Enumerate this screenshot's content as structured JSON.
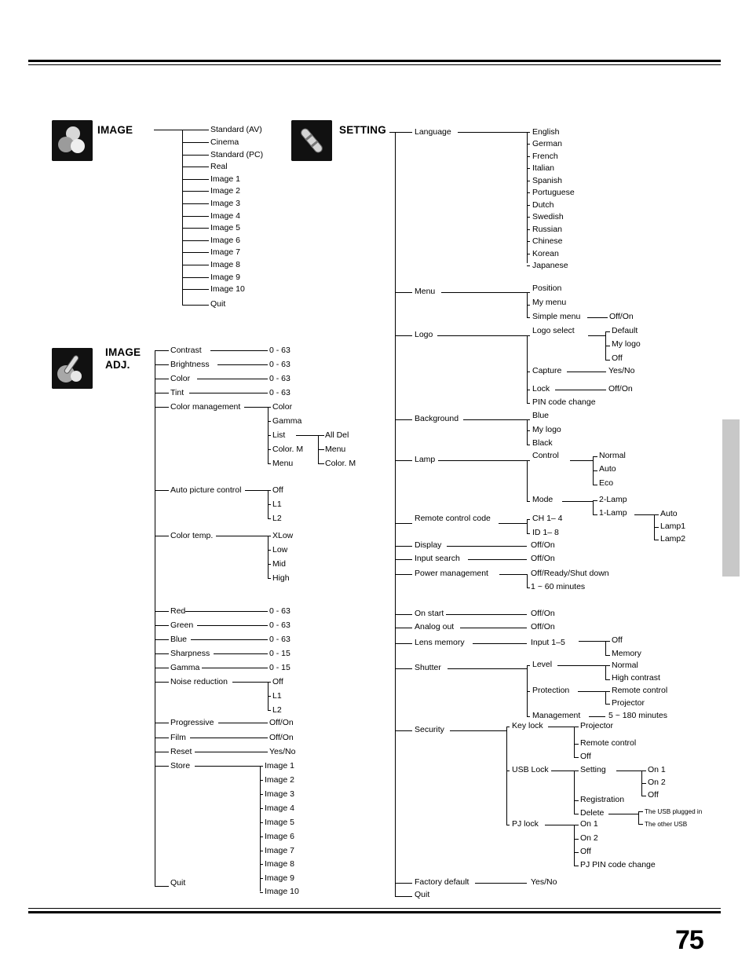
{
  "page": {
    "number": "75"
  },
  "sections": {
    "image": {
      "title": "IMAGE",
      "icon": "image-icon",
      "items": [
        "Standard (AV)",
        "Cinema",
        "Standard (PC)",
        "Real",
        "Image 1",
        "Image 2",
        "Image 3",
        "Image 4",
        "Image 5",
        "Image 6",
        "Image 7",
        "Image 8",
        "Image 9",
        "Image 10",
        "Quit"
      ]
    },
    "image_adj": {
      "title_line1": "IMAGE",
      "title_line2": "ADJ.",
      "icon": "image-adj-icon",
      "items": [
        {
          "label": "Contrast",
          "value": "0 - 63"
        },
        {
          "label": "Brightness",
          "value": "0 - 63"
        },
        {
          "label": "Color",
          "value": "0 - 63"
        },
        {
          "label": "Tint",
          "value": "0 - 63"
        },
        {
          "label": "Color management",
          "value": ""
        },
        {
          "label": "Auto picture control",
          "value": ""
        },
        {
          "label": "Color temp.",
          "value": ""
        },
        {
          "label": "Red",
          "value": "0 - 63"
        },
        {
          "label": "Green",
          "value": "0 - 63"
        },
        {
          "label": "Blue",
          "value": "0 - 63"
        },
        {
          "label": "Sharpness",
          "value": "0 - 15"
        },
        {
          "label": "Gamma",
          "value": "0 - 15"
        },
        {
          "label": "Noise reduction",
          "value": ""
        },
        {
          "label": "Progressive",
          "value": "Off/On"
        },
        {
          "label": "Film",
          "value": "Off/On"
        },
        {
          "label": "Reset",
          "value": "Yes/No"
        },
        {
          "label": "Store",
          "value": ""
        },
        {
          "label": "Quit",
          "value": ""
        }
      ],
      "color_management": [
        "Color",
        "Gamma",
        "List",
        "Color. M",
        "Menu"
      ],
      "color_management_sub": [
        "All Del",
        "Menu",
        "Color. M"
      ],
      "auto_picture_control": [
        "Off",
        "L1",
        "L2"
      ],
      "color_temp": [
        "XLow",
        "Low",
        "Mid",
        "High"
      ],
      "noise_reduction": [
        "Off",
        "L1",
        "L2"
      ],
      "store": [
        "Image 1",
        "Image 2",
        "Image 3",
        "Image 4",
        "Image 5",
        "Image 6",
        "Image 7",
        "Image 8",
        "Image 9",
        "Image 10"
      ]
    },
    "setting": {
      "title": "SETTING",
      "icon": "setting-icon",
      "language_label": "Language",
      "languages": [
        "English",
        "German",
        "French",
        "Italian",
        "Spanish",
        "Portuguese",
        "Dutch",
        "Swedish",
        "Russian",
        "Chinese",
        "Korean",
        "Japanese"
      ],
      "menu_label": "Menu",
      "menu_items": [
        "Position",
        "My menu",
        "Simple menu"
      ],
      "menu_simple_value": "Off/On",
      "logo_label": "Logo",
      "logo_items": [
        "Logo select",
        "Capture",
        "Lock",
        "PIN code change"
      ],
      "logo_select_items": [
        "Default",
        "My logo",
        "Off"
      ],
      "capture_value": "Yes/No",
      "lock_value": "Off/On",
      "background_label": "Background",
      "background_items": [
        "Blue",
        "My logo",
        "Black"
      ],
      "lamp_label": "Lamp",
      "lamp_items": [
        "Control",
        "Mode"
      ],
      "lamp_control_items": [
        "Normal",
        "Auto",
        "Eco"
      ],
      "lamp_mode_items": [
        "2-Lamp",
        "1-Lamp"
      ],
      "lamp_1lamp_items": [
        "Auto",
        "Lamp1",
        "Lamp2"
      ],
      "remote_label": "Remote control code",
      "remote_items": [
        "CH 1– 4",
        "ID 1– 8"
      ],
      "display_label": "Display",
      "display_value": "Off/On",
      "input_search_label": "Input search",
      "input_search_value": "Off/On",
      "power_mgmt_label": "Power management",
      "power_mgmt_items": [
        "Off/Ready/Shut down",
        "1 ~ 60 minutes"
      ],
      "on_start_label": "On start",
      "on_start_value": "Off/On",
      "analog_out_label": "Analog out",
      "analog_out_value": "Off/On",
      "lens_memory_label": "Lens memory",
      "lens_memory_value": "Input 1–5",
      "lens_memory_items": [
        "Off",
        "Memory"
      ],
      "shutter_label": "Shutter",
      "shutter_items": [
        "Level",
        "Protection",
        "Management"
      ],
      "shutter_level_items": [
        "Normal",
        "High contrast"
      ],
      "shutter_protection_items": [
        "Remote control",
        "Projector"
      ],
      "shutter_mgmt_value": "5 ~ 180 minutes",
      "security_label": "Security",
      "security_items": [
        "Key lock",
        "USB Lock",
        "PJ lock"
      ],
      "key_lock_items": [
        "Projector",
        "Remote control",
        "Off"
      ],
      "usb_lock_items": [
        "Setting",
        "Registration",
        "Delete"
      ],
      "usb_setting_items": [
        "On 1",
        "On 2",
        "Off"
      ],
      "usb_delete_items": [
        "The USB plugged in",
        "The other USB"
      ],
      "pj_lock_items": [
        "On 1",
        "On 2",
        "Off",
        "PJ PIN code change"
      ],
      "factory_default_label": "Factory default",
      "factory_default_value": "Yes/No",
      "quit_label": "Quit"
    }
  }
}
